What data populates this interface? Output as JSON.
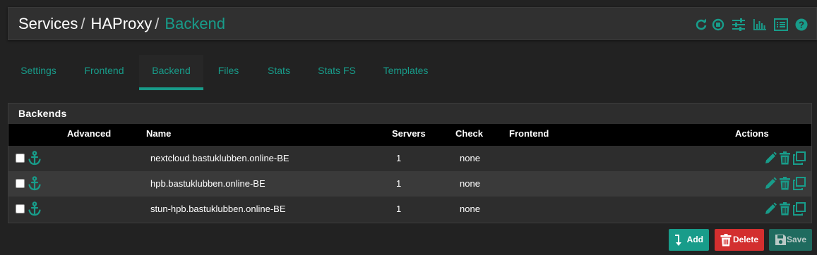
{
  "breadcrumb": {
    "part1": "Services",
    "part2": "HAProxy",
    "part3": "Backend",
    "separator": "/"
  },
  "header_icons": [
    "refresh-icon",
    "stop-circle-icon",
    "sliders-icon",
    "bar-chart-icon",
    "list-icon",
    "help-icon"
  ],
  "tabs": [
    {
      "label": "Settings"
    },
    {
      "label": "Frontend"
    },
    {
      "label": "Backend"
    },
    {
      "label": "Files"
    },
    {
      "label": "Stats"
    },
    {
      "label": "Stats FS"
    },
    {
      "label": "Templates"
    }
  ],
  "active_tab": "Backend",
  "panel": {
    "title": "Backends"
  },
  "table": {
    "headers": {
      "advanced": "Advanced",
      "name": "Name",
      "servers": "Servers",
      "check": "Check",
      "frontend": "Frontend",
      "actions": "Actions"
    },
    "rows": [
      {
        "name": "nextcloud.bastuklubben.online-BE",
        "servers": "1",
        "check": "none",
        "frontend": ""
      },
      {
        "name": "hpb.bastuklubben.online-BE",
        "servers": "1",
        "check": "none",
        "frontend": ""
      },
      {
        "name": "stun-hpb.bastuklubben.online-BE",
        "servers": "1",
        "check": "none",
        "frontend": ""
      }
    ]
  },
  "buttons": {
    "add": "Add",
    "delete": "Delete",
    "save": "Save"
  },
  "colors": {
    "accent": "#189c8a",
    "danger": "#d32f2f",
    "background": "#222222",
    "table_header": "#000000"
  }
}
